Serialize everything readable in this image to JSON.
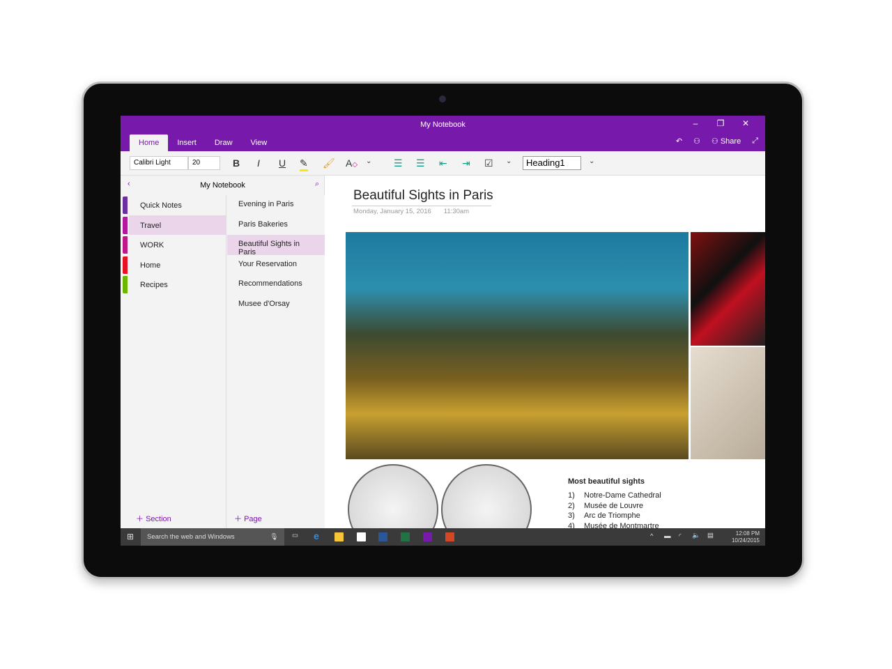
{
  "window": {
    "title": "My Notebook",
    "minimize": "–",
    "restore": "❐",
    "close": "✕"
  },
  "ribbon": {
    "tabs": [
      {
        "label": "Home",
        "active": true
      },
      {
        "label": "Insert"
      },
      {
        "label": "Draw"
      },
      {
        "label": "View"
      }
    ],
    "share_label": "Share",
    "font_name": "Calibri Light",
    "font_size": "20",
    "style": "Heading1"
  },
  "nav": {
    "notebook": "My Notebook",
    "sections": [
      {
        "label": "Quick Notes",
        "color": "#6b2fa0"
      },
      {
        "label": "Travel",
        "color": "#b5179e",
        "active": true
      },
      {
        "label": "WORK",
        "color": "#c0168a"
      },
      {
        "label": "Home",
        "color": "#e81123"
      },
      {
        "label": "Recipes",
        "color": "#6bb700"
      }
    ],
    "pages": [
      {
        "label": "Evening in Paris"
      },
      {
        "label": "Paris Bakeries"
      },
      {
        "label": "Beautiful Sights in Paris",
        "active": true
      },
      {
        "label": "Your Reservation"
      },
      {
        "label": "Recommendations"
      },
      {
        "label": "Musee d'Orsay"
      }
    ],
    "add_section": "Section",
    "add_page": "Page"
  },
  "page": {
    "title": "Beautiful Sights in Paris",
    "date": "Monday, January 15, 2016",
    "time": "11:30am",
    "list_heading": "Most beautiful sights",
    "list": [
      {
        "n": "1)",
        "t": "Notre-Dame Cathedral"
      },
      {
        "n": "2)",
        "t": "Musée de Louvre"
      },
      {
        "n": "3)",
        "t": "Arc de Triomphe"
      },
      {
        "n": "4)",
        "t": "Musée de Montmartre"
      }
    ]
  },
  "taskbar": {
    "search_placeholder": "Search the web and Windows",
    "time": "12:08 PM",
    "date": "10/24/2015"
  },
  "colors": {
    "accent": "#7719aa"
  }
}
